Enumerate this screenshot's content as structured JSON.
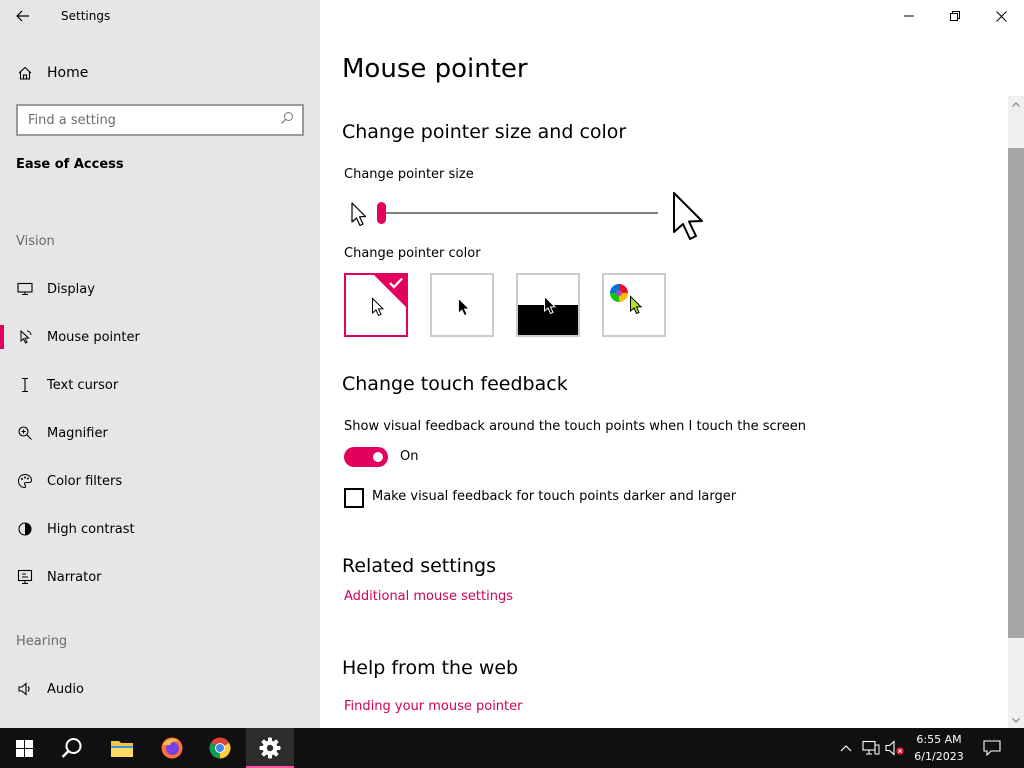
{
  "window": {
    "title": "Settings"
  },
  "sidebar": {
    "home_label": "Home",
    "search_placeholder": "Find a setting",
    "section_title": "Ease of Access",
    "groups": {
      "vision": "Vision",
      "hearing": "Hearing"
    },
    "items": [
      {
        "label": "Display",
        "icon": "monitor-icon"
      },
      {
        "label": "Mouse pointer",
        "icon": "mouse-pointer-icon",
        "active": true
      },
      {
        "label": "Text cursor",
        "icon": "text-cursor-icon"
      },
      {
        "label": "Magnifier",
        "icon": "magnifier-icon"
      },
      {
        "label": "Color filters",
        "icon": "palette-icon"
      },
      {
        "label": "High contrast",
        "icon": "contrast-icon"
      },
      {
        "label": "Narrator",
        "icon": "narrator-icon"
      },
      {
        "label": "Audio",
        "icon": "speaker-icon"
      }
    ]
  },
  "main": {
    "title": "Mouse pointer",
    "pointer_section": {
      "heading": "Change pointer size and color",
      "size_label": "Change pointer size",
      "size_value_fraction": 0.0,
      "color_label": "Change pointer color",
      "color_options": [
        {
          "name": "white",
          "selected": true
        },
        {
          "name": "black",
          "selected": false
        },
        {
          "name": "inverted",
          "selected": false
        },
        {
          "name": "custom",
          "selected": false
        }
      ]
    },
    "touch_section": {
      "heading": "Change touch feedback",
      "description": "Show visual feedback around the touch points when I touch the screen",
      "toggle_state": "On",
      "checkbox_label": "Make visual feedback for touch points darker and larger",
      "checkbox_checked": false
    },
    "related": {
      "heading": "Related settings",
      "link": "Additional mouse settings"
    },
    "help": {
      "heading": "Help from the web",
      "link": "Finding your mouse pointer"
    }
  },
  "colors": {
    "accent": "#e3005f",
    "sidebar_bg": "#e6e6e6",
    "taskbar_bg": "#101010"
  },
  "taskbar": {
    "apps": [
      "start-icon",
      "search-icon",
      "file-explorer-icon",
      "firefox-icon",
      "chrome-icon",
      "settings-icon"
    ],
    "active_app": "settings-icon",
    "time": "6:55 AM",
    "date": "6/1/2023"
  }
}
